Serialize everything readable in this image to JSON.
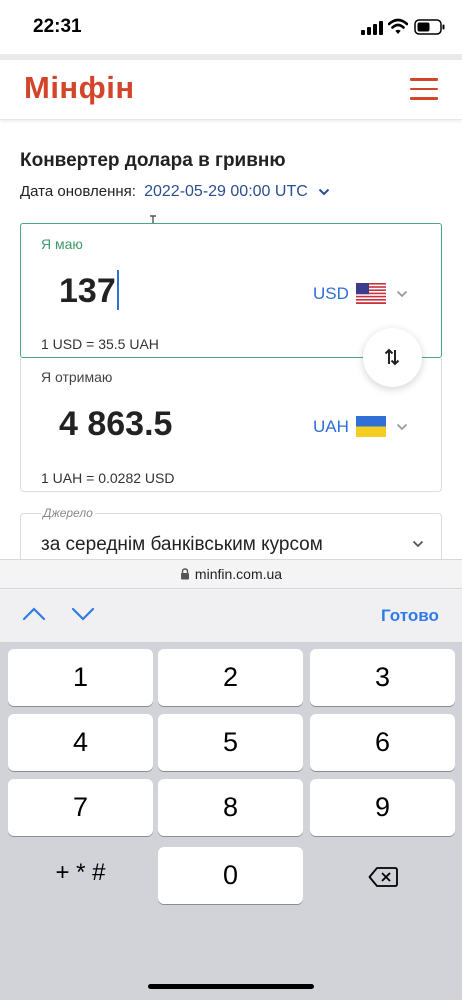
{
  "status_bar": {
    "time": "22:31"
  },
  "header": {
    "logo": "Мінфін"
  },
  "converter": {
    "title": "Конвертер долара в гривню",
    "update_label": "Дата оновлення:",
    "update_value": "2022-05-29 00:00 UTC",
    "have": {
      "label": "Я маю",
      "amount": "137",
      "currency": "USD",
      "rate": "1 USD = 35.5 UAH"
    },
    "get": {
      "label": "Я отримаю",
      "amount": "4 863.5",
      "currency": "UAH",
      "rate": "1 UAH = 0.0282 USD"
    },
    "source": {
      "label": "Джерело",
      "value": "за середнім банківським курсом"
    }
  },
  "browser": {
    "url": "minfin.com.ua"
  },
  "accessory": {
    "done": "Готово"
  },
  "keypad": {
    "k1": "1",
    "k2": "2",
    "k3": "3",
    "k4": "4",
    "k5": "5",
    "k6": "6",
    "k7": "7",
    "k8": "8",
    "k9": "9",
    "k0": "0",
    "symbols": "+ * #"
  },
  "colors": {
    "brand": "#d2452b",
    "accent": "#2f6fd6",
    "active_border": "#4aa87a"
  },
  "icons": [
    "signal-icon",
    "wifi-icon",
    "battery-icon",
    "hamburger-menu-icon",
    "chevron-down-icon",
    "us-flag-icon",
    "ua-flag-icon",
    "swap-icon",
    "lock-icon",
    "chevron-up-icon",
    "backspace-icon"
  ]
}
